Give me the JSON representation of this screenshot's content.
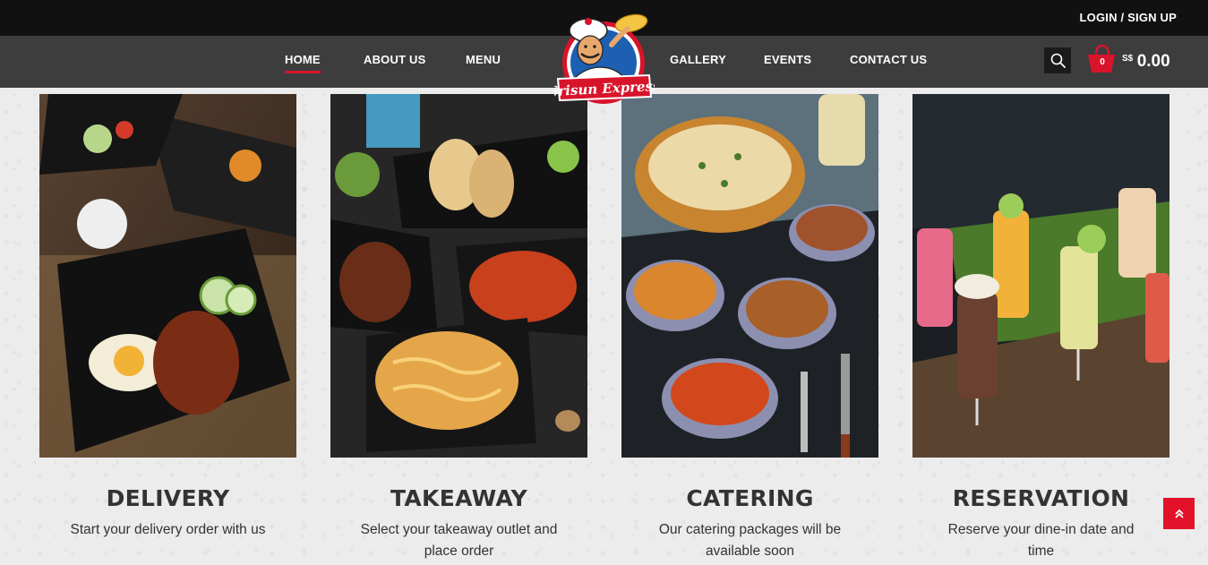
{
  "header": {
    "login_label": "LOGIN / SIGN UP",
    "nav": [
      {
        "label": "HOME"
      },
      {
        "label": "ABOUT US"
      },
      {
        "label": "MENU"
      },
      {
        "label": "GALLERY"
      },
      {
        "label": "EVENTS"
      },
      {
        "label": "CONTACT US"
      }
    ],
    "logo": {
      "text": "Srisun Express",
      "icon": "chef-logo"
    },
    "search_icon": "search-icon",
    "cart": {
      "count": "0",
      "currency": "S$",
      "total": "0.00",
      "icon": "basket-icon"
    }
  },
  "services": [
    {
      "title": "DELIVERY",
      "description": "Start your delivery order with us",
      "image": "plated-rice-with-fried-egg-photo"
    },
    {
      "title": "TAKEAWAY",
      "description": "Select your takeaway outlet and place order",
      "image": "wraps-wings-and-fries-photo"
    },
    {
      "title": "CATERING",
      "description": "Our catering packages will be available soon",
      "image": "naan-and-curries-photo"
    },
    {
      "title": "RESERVATION",
      "description": "Reserve your dine-in date and time",
      "image": "assorted-drinks-photo"
    }
  ],
  "scroll_top_icon": "double-chevron-up-icon",
  "colors": {
    "accent": "#d8142a",
    "topbar": "#111111",
    "navbar": "#3d3d3d",
    "text": "#333333"
  }
}
